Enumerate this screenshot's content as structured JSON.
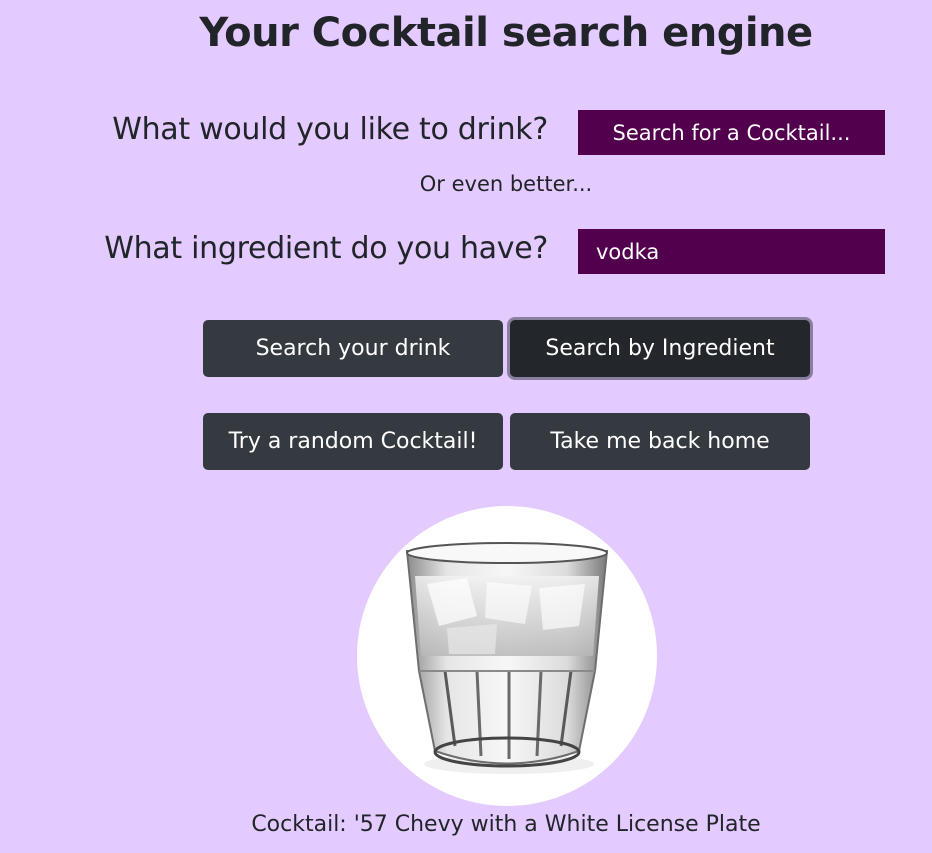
{
  "header": {
    "title": "Your Cocktail search engine"
  },
  "search": {
    "drink_question": "What would you like to drink?",
    "drink_placeholder": "Search for a Cocktail...",
    "separator": "Or even better...",
    "ingredient_question": "What ingredient do you have?",
    "ingredient_value": "vodka"
  },
  "buttons": {
    "search_drink": "Search your drink",
    "search_ingredient": "Search by Ingredient",
    "random": "Try a random Cocktail!",
    "home": "Take me back home"
  },
  "result": {
    "image_icon": "cocktail-glass-image",
    "caption": "Cocktail: '57 Chevy with a White License Plate"
  },
  "colors": {
    "background": "#e3caff",
    "input_bg": "#52004d",
    "button_bg": "#343a40"
  }
}
